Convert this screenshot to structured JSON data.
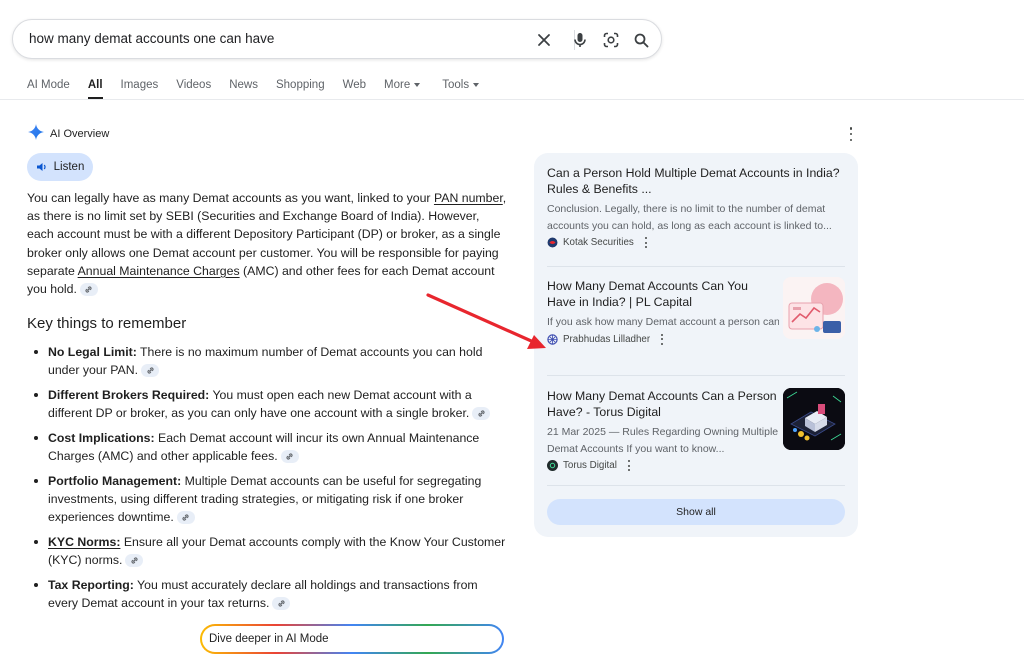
{
  "search": {
    "query": "how many demat accounts one can have",
    "icons": [
      "close-icon",
      "mic-icon",
      "lens-icon",
      "search-icon"
    ]
  },
  "tabs": [
    {
      "label": "AI Mode",
      "active": false
    },
    {
      "label": "All",
      "active": true
    },
    {
      "label": "Images",
      "active": false
    },
    {
      "label": "Videos",
      "active": false
    },
    {
      "label": "News",
      "active": false
    },
    {
      "label": "Shopping",
      "active": false
    },
    {
      "label": "Web",
      "active": false
    },
    {
      "label": "More",
      "active": false,
      "dropdown": true
    },
    {
      "label": "Tools",
      "active": false,
      "dropdown": true
    }
  ],
  "overview": {
    "title": "AI Overview",
    "listen_label": "Listen",
    "para": {
      "t1": "You can legally have as many Demat accounts as you want, linked to your ",
      "link1": "PAN number",
      "t2": ", as there is no limit set by SEBI (Securities and Exchange Board of India). However, each account must be with a different Depository Participant (DP) or broker, as a single broker only allows one Demat account per customer. You will be responsible for paying separate ",
      "link2": "Annual Maintenance Charges",
      "t3": " (AMC) and other fees for each Demat account you hold."
    },
    "heading": "Key things to remember",
    "bullets": [
      {
        "bold": "No Legal Limit:",
        "text": " There is no maximum number of Demat accounts you can hold under your PAN."
      },
      {
        "bold": "Different Brokers Required:",
        "text": " You must open each new Demat account with a different DP or broker, as you can only have one account with a single broker."
      },
      {
        "bold": "Cost Implications:",
        "text": " Each Demat account will incur its own Annual Maintenance Charges (AMC) and other applicable fees."
      },
      {
        "bold": "Portfolio Management:",
        "text": " Multiple Demat accounts can be useful for segregating investments, using different trading strategies, or mitigating risk if one broker experiences downtime."
      },
      {
        "bold": "KYC Norms:",
        "text": " Ensure all your Demat accounts comply with the Know Your Customer (KYC) norms."
      },
      {
        "bold": "Tax Reporting:",
        "text": " You must accurately declare all holdings and transactions from every Demat account in your tax returns."
      }
    ],
    "dive_label": "Dive deeper in AI Mode"
  },
  "sources": {
    "cards": [
      {
        "title": "Can a Person Hold Multiple Demat Accounts in India? Rules & Benefits ...",
        "snippet": "Conclusion. Legally, there is no limit to the number of demat accounts you can hold, as long as each account is linked to...",
        "source": "Kotak Securities"
      },
      {
        "title": "How Many Demat Accounts Can You Have in India? | PL Capital",
        "snippet": "If you ask how many Demat account a person can have, you can open more than one Demat...",
        "source": "Prabhudas Lilladher"
      },
      {
        "title": "How Many Demat Accounts Can a Person Have? - Torus Digital",
        "snippet": "21 Mar 2025 — Rules Regarding Owning Multiple Demat Accounts If you want to know...",
        "source": "Torus Digital"
      }
    ],
    "show_all_label": "Show all"
  },
  "annotation": {
    "color": "#e8262e",
    "icon": "red-arrow"
  }
}
